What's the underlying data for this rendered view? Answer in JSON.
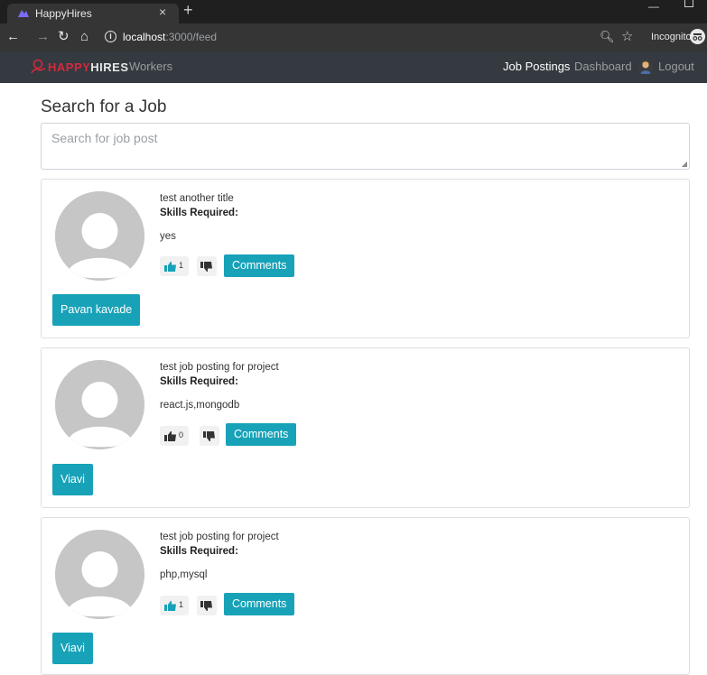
{
  "browser": {
    "tab_title": "HappyHires",
    "url_host": "localhost",
    "url_path": ":3000/feed",
    "incognito_label": "Incognito"
  },
  "navbar": {
    "brand_happy": "HAPPY",
    "brand_hires": "HIRES",
    "workers": "Workers",
    "job_postings": "Job Postings",
    "dashboard": "Dashboard",
    "logout": "Logout"
  },
  "page": {
    "title": "Search for a Job",
    "search_placeholder": "Search for job post"
  },
  "posts": [
    {
      "title": "test another title",
      "skills_label": "Skills Required:",
      "skills": "yes",
      "likes": "1",
      "comments_label": "Comments",
      "author": "Pavan kavade"
    },
    {
      "title": "test job posting for project",
      "skills_label": "Skills Required:",
      "skills": "react.js,mongodb",
      "likes": "0",
      "comments_label": "Comments",
      "author": "Viavi"
    },
    {
      "title": "test job posting for project",
      "skills_label": "Skills Required:",
      "skills": "php,mysql",
      "likes": "1",
      "comments_label": "Comments",
      "author": "Viavi"
    }
  ],
  "colors": {
    "accent": "#17a2b8",
    "navbar": "#343a40",
    "brand_red": "#d8283d"
  },
  "icons": [
    "incognito-icon",
    "thumbs-up-icon",
    "thumbs-down-icon",
    "avatar-placeholder-icon"
  ]
}
